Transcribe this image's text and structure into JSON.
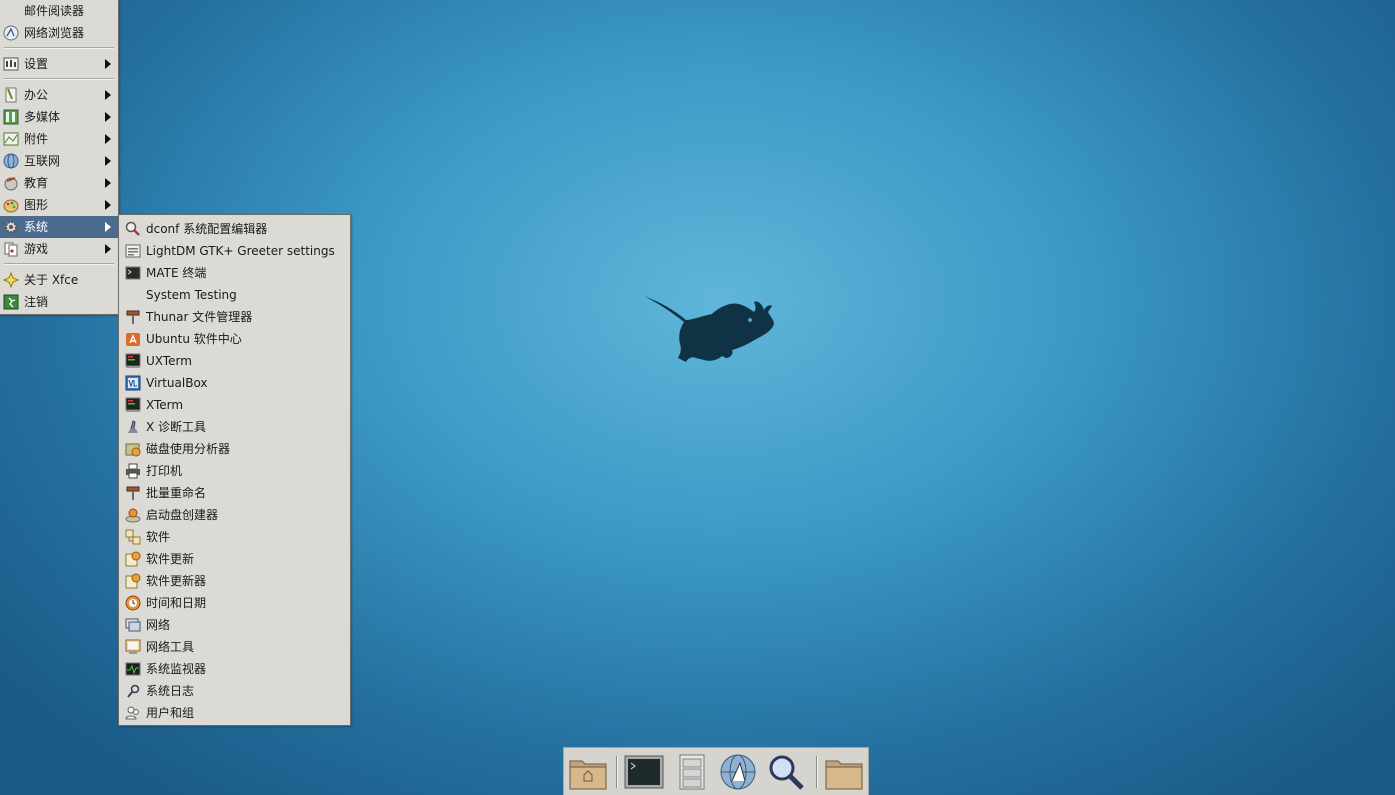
{
  "main_menu": {
    "items": [
      {
        "label": "邮件阅读器",
        "icon": "mail-icon",
        "submenu": false
      },
      {
        "label": "网络浏览器",
        "icon": "web-browser-icon",
        "submenu": false
      },
      {
        "label": "设置",
        "icon": "settings-icon",
        "submenu": true
      },
      {
        "label": "办公",
        "icon": "office-icon",
        "submenu": true
      },
      {
        "label": "多媒体",
        "icon": "multimedia-icon",
        "submenu": true
      },
      {
        "label": "附件",
        "icon": "accessories-icon",
        "submenu": true
      },
      {
        "label": "互联网",
        "icon": "internet-icon",
        "submenu": true
      },
      {
        "label": "教育",
        "icon": "education-icon",
        "submenu": true
      },
      {
        "label": "图形",
        "icon": "graphics-icon",
        "submenu": true
      },
      {
        "label": "系统",
        "icon": "system-icon",
        "submenu": true,
        "active": true
      },
      {
        "label": "游戏",
        "icon": "games-icon",
        "submenu": true
      },
      {
        "label": "关于 Xfce",
        "icon": "about-icon",
        "submenu": false
      },
      {
        "label": "注销",
        "icon": "logout-icon",
        "submenu": false
      }
    ]
  },
  "system_submenu": {
    "items": [
      {
        "label": "dconf 系统配置编辑器",
        "icon": "dconf-editor-icon"
      },
      {
        "label": "LightDM GTK+ Greeter settings",
        "icon": "lightdm-settings-icon"
      },
      {
        "label": "MATE 终端",
        "icon": "terminal-icon"
      },
      {
        "label": "System Testing",
        "icon": ""
      },
      {
        "label": "Thunar 文件管理器",
        "icon": "file-manager-icon"
      },
      {
        "label": "Ubuntu 软件中心",
        "icon": "software-center-icon"
      },
      {
        "label": "UXTerm",
        "icon": "uxterm-icon"
      },
      {
        "label": "VirtualBox",
        "icon": "virtualbox-icon"
      },
      {
        "label": "XTerm",
        "icon": "xterm-icon"
      },
      {
        "label": "X 诊断工具",
        "icon": "x-diagnostic-icon"
      },
      {
        "label": "磁盘使用分析器",
        "icon": "disk-analyzer-icon"
      },
      {
        "label": "打印机",
        "icon": "printer-icon"
      },
      {
        "label": "批量重命名",
        "icon": "bulk-rename-icon"
      },
      {
        "label": "启动盘创建器",
        "icon": "startup-disk-icon"
      },
      {
        "label": "软件",
        "icon": "software-icon"
      },
      {
        "label": "软件更新",
        "icon": "software-update-icon"
      },
      {
        "label": "软件更新器",
        "icon": "software-updater-icon"
      },
      {
        "label": "时间和日期",
        "icon": "time-date-icon"
      },
      {
        "label": "网络",
        "icon": "network-icon"
      },
      {
        "label": "网络工具",
        "icon": "network-tools-icon"
      },
      {
        "label": "系统监视器",
        "icon": "system-monitor-icon"
      },
      {
        "label": "系统日志",
        "icon": "system-log-icon"
      },
      {
        "label": "用户和组",
        "icon": "users-groups-icon"
      }
    ]
  },
  "dock": {
    "items": [
      {
        "icon": "home-folder-icon"
      },
      {
        "icon": "terminal-icon"
      },
      {
        "icon": "file-cabinet-icon"
      },
      {
        "icon": "web-browser-icon"
      },
      {
        "icon": "search-icon"
      },
      {
        "icon": "folder-icon"
      }
    ]
  },
  "colors": {
    "accent": "#4a6a8e",
    "menu_bg": "#dcdad5"
  }
}
